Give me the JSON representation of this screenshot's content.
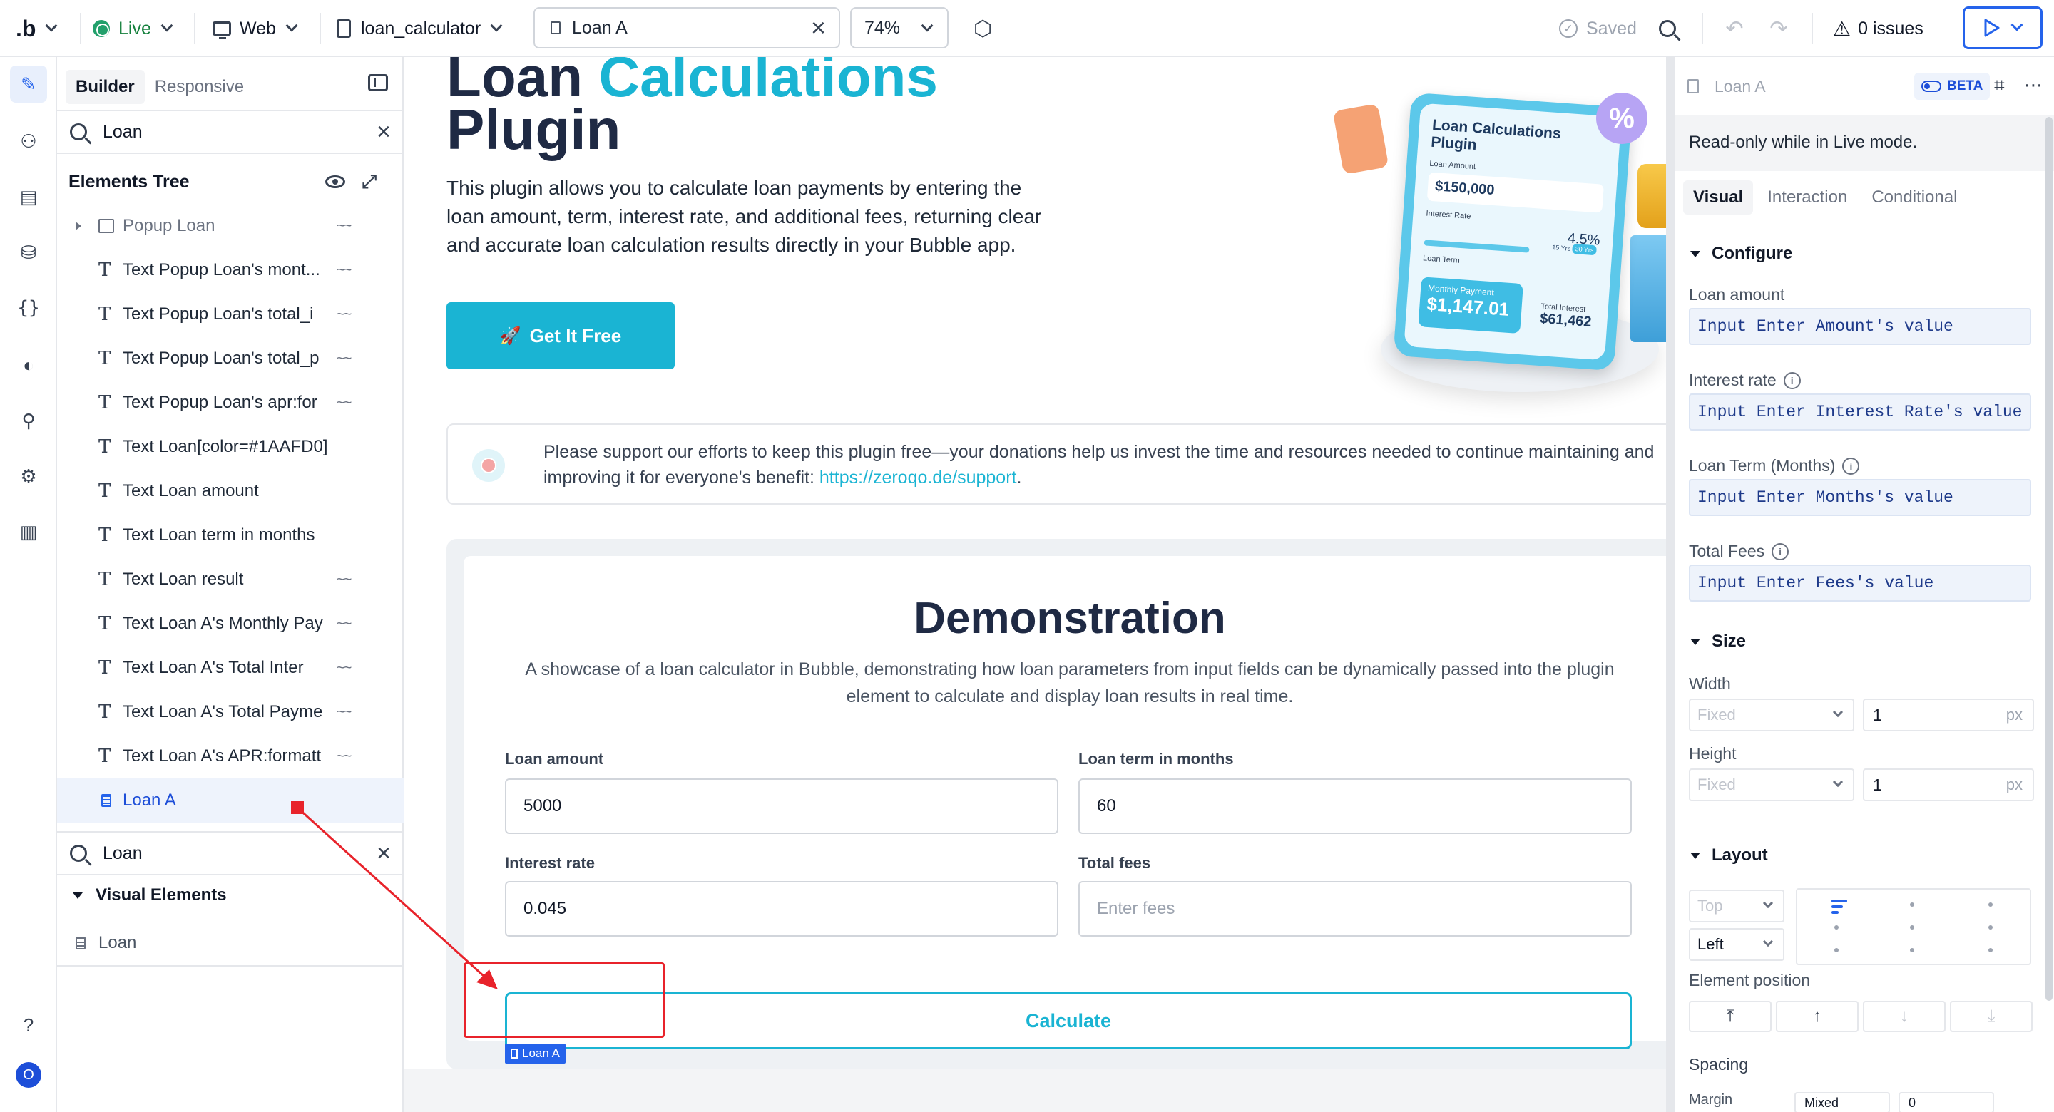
{
  "topbar": {
    "logo": ".b",
    "mode": "Live",
    "platform": "Web",
    "page": "loan_calculator",
    "element_tab": "Loan A",
    "zoom": "74%",
    "saved": "Saved",
    "issues": "0 issues"
  },
  "left_panel": {
    "tabs": [
      "Builder",
      "Responsive"
    ],
    "search_value": "Loan",
    "tree_title": "Elements Tree",
    "tree_items": [
      {
        "label": "Popup Loan",
        "type": "popup",
        "hidden": true
      },
      {
        "label": "Text Popup Loan's mont...",
        "type": "text",
        "hidden": true
      },
      {
        "label": "Text Popup Loan's total_i",
        "type": "text",
        "hidden": true
      },
      {
        "label": "Text Popup Loan's total_p",
        "type": "text",
        "hidden": true
      },
      {
        "label": "Text Popup Loan's apr:for",
        "type": "text",
        "hidden": true
      },
      {
        "label": "Text Loan[color=#1AAFD0]",
        "type": "text",
        "hidden": false
      },
      {
        "label": "Text Loan amount",
        "type": "text",
        "hidden": false
      },
      {
        "label": "Text Loan term in months",
        "type": "text",
        "hidden": false
      },
      {
        "label": "Text Loan result",
        "type": "text",
        "hidden": true
      },
      {
        "label": "Text Loan A's Monthly Pay",
        "type": "text",
        "hidden": true
      },
      {
        "label": "Text Loan A's Total Inter",
        "type": "text",
        "hidden": true
      },
      {
        "label": "Text Loan A's Total Payme",
        "type": "text",
        "hidden": true
      },
      {
        "label": "Text Loan A's APR:formatt",
        "type": "text",
        "hidden": true
      },
      {
        "label": "Loan A",
        "type": "plugin",
        "hidden": false,
        "selected": true
      }
    ],
    "search2_value": "Loan",
    "visual_elements_title": "Visual Elements",
    "visual_elements": [
      "Loan"
    ]
  },
  "canvas": {
    "hero_title_part1": "Loan ",
    "hero_title_accent": "Calculations",
    "hero_title_line2": "Plugin",
    "hero_description": "This plugin allows you to calculate loan payments by entering the loan amount, term, interest rate, and additional fees, returning clear and accurate loan calculation results directly in your Bubble app.",
    "cta_label": "Get It Free",
    "illustration": {
      "title": "Loan Calculations Plugin",
      "amount_label": "Loan Amount",
      "amount": "$150,000",
      "rate_label": "Interest Rate",
      "rate": "4.5%",
      "term_label": "Loan Term",
      "term_options": [
        "15 Yrs",
        "30 Yrs"
      ],
      "payment_label": "Monthly Payment",
      "payment": "$1,147.01",
      "interest_label": "Total Interest",
      "interest": "$61,462",
      "badge": "%"
    },
    "donation_text": "Please support our efforts to keep this plugin free—your donations help us invest the time and resources needed to continue maintaining and improving it for everyone's benefit: ",
    "donation_link": "https://zeroqo.de/support",
    "donation_end": ".",
    "demo_title": "Demonstration",
    "demo_subtitle": "A showcase of a loan calculator in Bubble, demonstrating how loan parameters from input fields can be dynamically passed into the plugin element to calculate and display loan results in real time.",
    "fields": {
      "loan_amount": {
        "label": "Loan amount",
        "value": "5000"
      },
      "loan_term": {
        "label": "Loan term in months",
        "value": "60"
      },
      "interest_rate": {
        "label": "Interest rate",
        "value": "0.045"
      },
      "total_fees": {
        "label": "Total fees",
        "placeholder": "Enter fees"
      }
    },
    "calculate_label": "Calculate",
    "element_tag": "Loan A"
  },
  "right_panel": {
    "element_name": "Loan A",
    "beta_label": "BETA",
    "readonly_notice": "Read-only while in Live mode.",
    "tabs": [
      "Visual",
      "Interaction",
      "Conditional"
    ],
    "configure_title": "Configure",
    "fields": [
      {
        "label": "Loan amount",
        "value": "Input Enter Amount's value",
        "info": false
      },
      {
        "label": "Interest rate",
        "value": "Input Enter Interest Rate's value",
        "info": true
      },
      {
        "label": "Loan Term (Months)",
        "value": "Input Enter Months's value",
        "info": true
      },
      {
        "label": "Total Fees",
        "value": "Input Enter Fees's value",
        "info": true
      }
    ],
    "size_title": "Size",
    "width_label": "Width",
    "width_mode": "Fixed",
    "width_value": "1",
    "height_label": "Height",
    "height_mode": "Fixed",
    "height_value": "1",
    "unit": "px",
    "layout_title": "Layout",
    "vertical_align": "Top",
    "horizontal_align": "Left",
    "element_position_label": "Element position",
    "spacing_label": "Spacing",
    "margin_label": "Margin",
    "margin_value": "Mixed",
    "margin_value2": "0"
  },
  "colors": {
    "accent": "#1AB4D3",
    "primary": "#2563EB",
    "annotation_red": "#E8232B",
    "live_green": "#22A06B"
  }
}
